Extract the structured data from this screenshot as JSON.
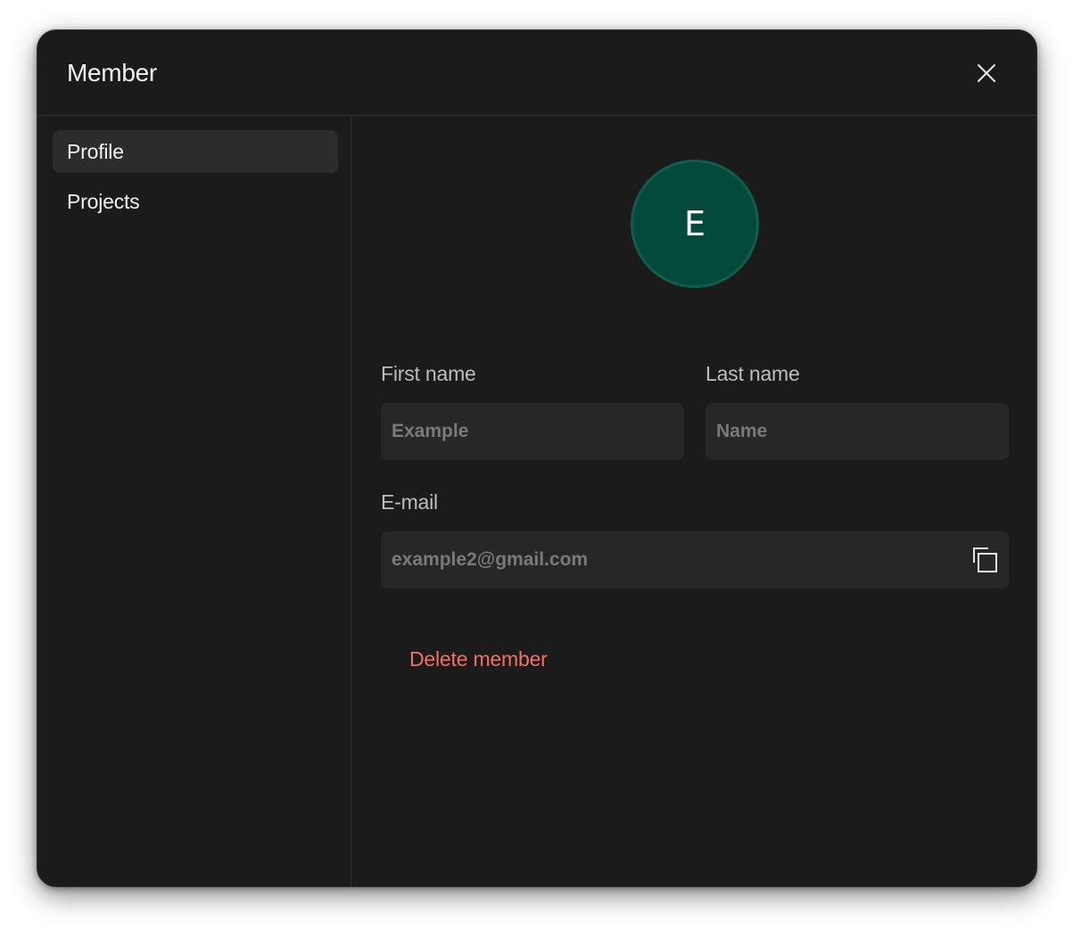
{
  "modal": {
    "title": "Member"
  },
  "sidebar": {
    "items": [
      {
        "label": "Profile",
        "active": true
      },
      {
        "label": "Projects",
        "active": false
      }
    ]
  },
  "profile": {
    "avatar_initial": "E",
    "avatar_color": "#044a3b",
    "first_name": {
      "label": "First name",
      "value": "",
      "placeholder": "Example"
    },
    "last_name": {
      "label": "Last name",
      "value": "",
      "placeholder": "Name"
    },
    "email": {
      "label": "E-mail",
      "value": "",
      "placeholder": "example2@gmail.com"
    },
    "delete_label": "Delete member",
    "delete_color": "#f07066"
  },
  "icons": {
    "close": "close-icon",
    "copy": "copy-icon"
  }
}
